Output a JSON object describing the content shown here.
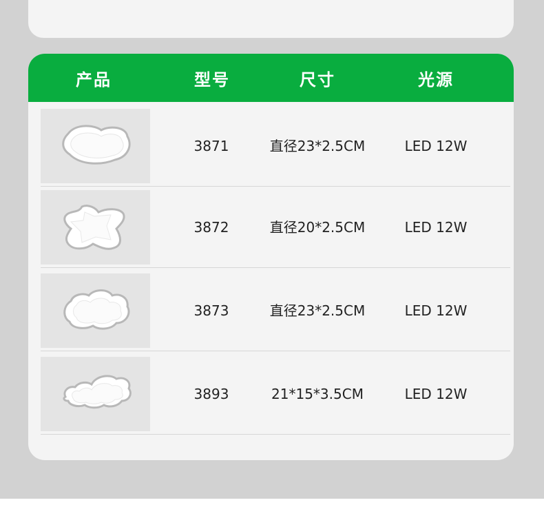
{
  "table": {
    "headers": {
      "product": "产品",
      "model": "型号",
      "size": "尺寸",
      "light_source": "光源"
    },
    "rows": [
      {
        "image_icon": "cloud-ceiling-lamp-icon",
        "model": "3871",
        "size": "直径23*2.5CM",
        "light_source": "LED 12W"
      },
      {
        "image_icon": "star-ceiling-lamp-icon",
        "model": "3872",
        "size": "直径20*2.5CM",
        "light_source": "LED 12W"
      },
      {
        "image_icon": "flower-cloud-ceiling-lamp-icon",
        "model": "3873",
        "size": "直径23*2.5CM",
        "light_source": "LED 12W"
      },
      {
        "image_icon": "double-cloud-ceiling-lamp-icon",
        "model": "3893",
        "size": "21*15*3.5CM",
        "light_source": "LED 12W"
      }
    ]
  },
  "colors": {
    "header_green": "#09ad3f",
    "card_background": "#f4f4f4",
    "page_background": "#d2d2d2"
  }
}
